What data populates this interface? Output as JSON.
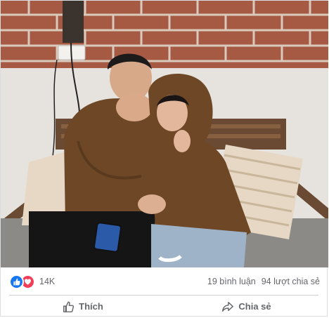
{
  "post": {
    "photo_alt": "",
    "reactions": {
      "types": [
        "like-icon",
        "love-icon"
      ],
      "count": "14K"
    },
    "comments": "19 bình luận",
    "shares": "94 lượt chia sẻ",
    "actions": {
      "like_label": "Thích",
      "share_label": "Chia sẻ"
    },
    "colors": {
      "like_blue": "#1877f2",
      "love_red": "#f33e58",
      "text_gray": "#65676b"
    }
  }
}
